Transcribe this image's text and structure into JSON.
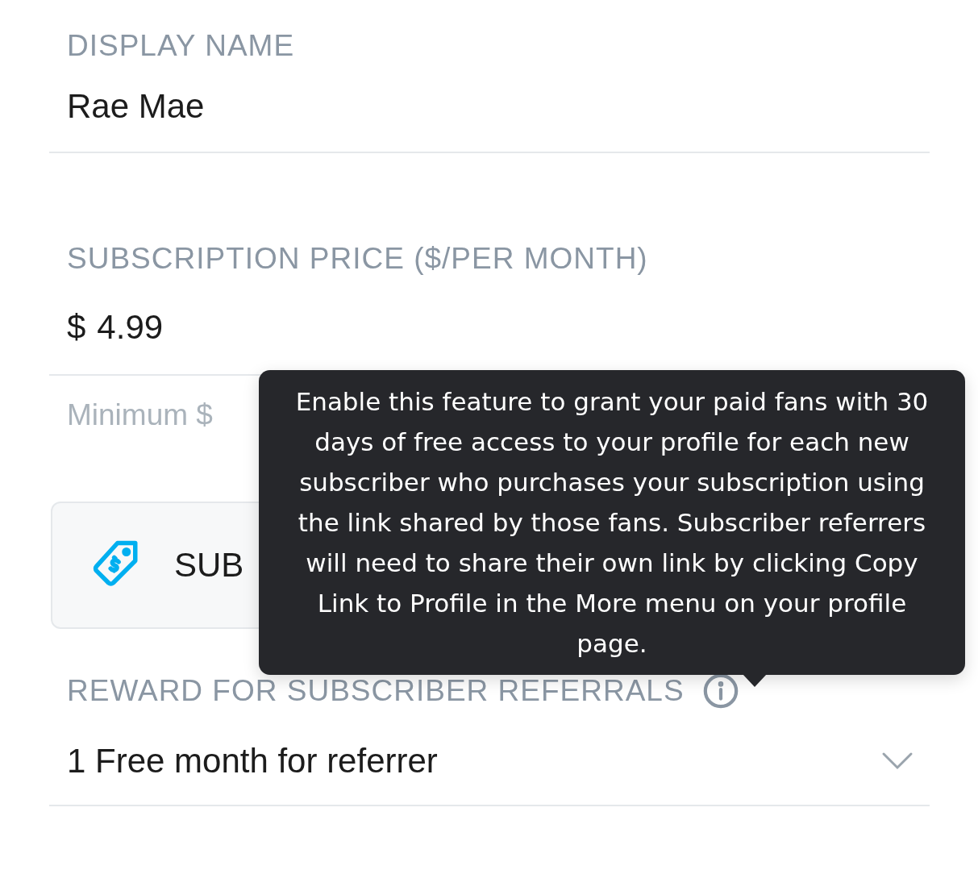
{
  "display_name": {
    "label": "DISPLAY NAME",
    "value": "Rae Mae"
  },
  "subscription_price": {
    "label": "SUBSCRIPTION PRICE ($/PER MONTH)",
    "currency": "$",
    "value": "4.99",
    "hint": "Minimum $"
  },
  "subscription_button": {
    "label": "SUB"
  },
  "tooltip": {
    "text": "Enable this feature to grant your paid fans with 30 days of free access to your profile for each new subscriber who purchases your subscription using the link shared by those fans. Subscriber referrers will need to share their own link by clicking Copy Link to Profile in the More menu on your profile page."
  },
  "referral_reward": {
    "label": "REWARD FOR SUBSCRIBER REFERRALS",
    "value": "1 Free month for referrer"
  }
}
